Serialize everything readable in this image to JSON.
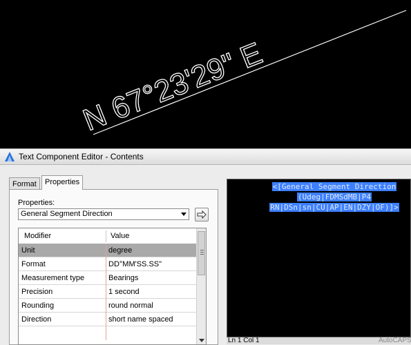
{
  "drawing": {
    "bearing_text": "N 67°23'29\" E",
    "line_color": "#ffffff"
  },
  "dialog": {
    "title": "Text Component Editor - Contents",
    "tabs": [
      {
        "label": "Format",
        "active": false
      },
      {
        "label": "Properties",
        "active": true
      }
    ],
    "properties_label": "Properties:",
    "selected_property": "General Segment Direction",
    "grid": {
      "headers": {
        "modifier": "Modifier",
        "value": "Value"
      },
      "rows": [
        {
          "modifier": "Unit",
          "value": "degree",
          "selected": true
        },
        {
          "modifier": "Format",
          "value": "DD°MM'SS.SS\""
        },
        {
          "modifier": "Measurement type",
          "value": "Bearings"
        },
        {
          "modifier": "Precision",
          "value": "1 second"
        },
        {
          "modifier": "Rounding",
          "value": "round normal"
        },
        {
          "modifier": "Direction",
          "value": "short name spaced"
        }
      ]
    },
    "preview": {
      "lines": [
        "<[General Segment Direction",
        "(Udeg|FDMSdMB|P4",
        "RN|DSn|sn|CU|AP|EN|DZY|OF)]>"
      ],
      "highlight_color": "#3d80ff"
    },
    "status": {
      "position": "Ln 1 Col 1",
      "caps": "AutoCAPS"
    }
  }
}
